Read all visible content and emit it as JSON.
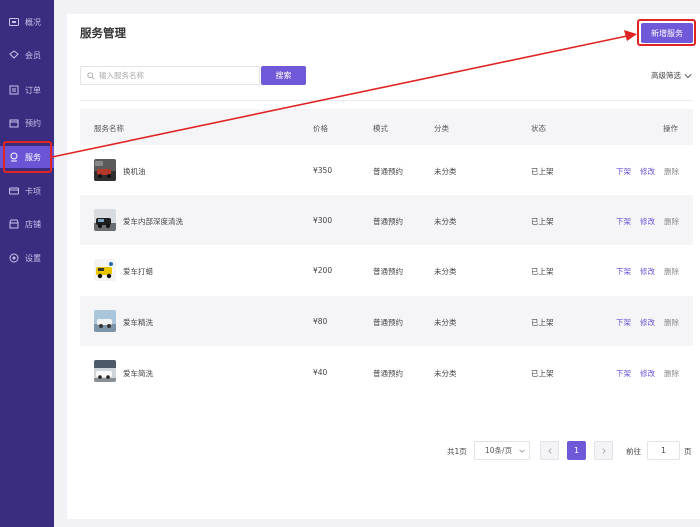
{
  "sidebar": {
    "items": [
      {
        "label": "概况",
        "icon": "overview-icon"
      },
      {
        "label": "会员",
        "icon": "member-icon"
      },
      {
        "label": "订单",
        "icon": "order-icon"
      },
      {
        "label": "预约",
        "icon": "booking-icon"
      },
      {
        "label": "服务",
        "icon": "service-icon",
        "active": true
      },
      {
        "label": "卡项",
        "icon": "card-icon"
      },
      {
        "label": "店铺",
        "icon": "store-icon"
      },
      {
        "label": "设置",
        "icon": "settings-icon"
      }
    ]
  },
  "header": {
    "title": "服务管理",
    "new_button": "新增服务"
  },
  "search": {
    "placeholder": "输入服务名称",
    "button": "搜索",
    "advanced": "高级筛选"
  },
  "table": {
    "columns": [
      "服务名称",
      "价格",
      "模式",
      "分类",
      "状态",
      "操作"
    ],
    "rows": [
      {
        "name": "换机油",
        "price": "¥350",
        "mode": "普通预约",
        "category": "未分类",
        "status": "已上架",
        "thumb": "oil-change"
      },
      {
        "name": "爱车内部深度清洗",
        "price": "¥300",
        "mode": "普通预约",
        "category": "未分类",
        "status": "已上架",
        "thumb": "interior-cleaning"
      },
      {
        "name": "爱车打蜡",
        "price": "¥200",
        "mode": "普通预约",
        "category": "未分类",
        "status": "已上架",
        "thumb": "car-waxing"
      },
      {
        "name": "爱车精洗",
        "price": "¥80",
        "mode": "普通预约",
        "category": "未分类",
        "status": "已上架",
        "thumb": "car-detailing"
      },
      {
        "name": "爱车简洗",
        "price": "¥40",
        "mode": "普通预约",
        "category": "未分类",
        "status": "已上架",
        "thumb": "car-wash"
      }
    ],
    "actions": [
      "下架",
      "修改",
      "删除"
    ]
  },
  "pagination": {
    "total": "共1页",
    "page_size": "10条/页",
    "current_page": "1",
    "goto_label": "前往",
    "goto_value": "1",
    "page_unit": "页"
  },
  "colors": {
    "sidebar": "#3a2d80",
    "accent": "#7059d9",
    "highlight": "#e02424"
  }
}
